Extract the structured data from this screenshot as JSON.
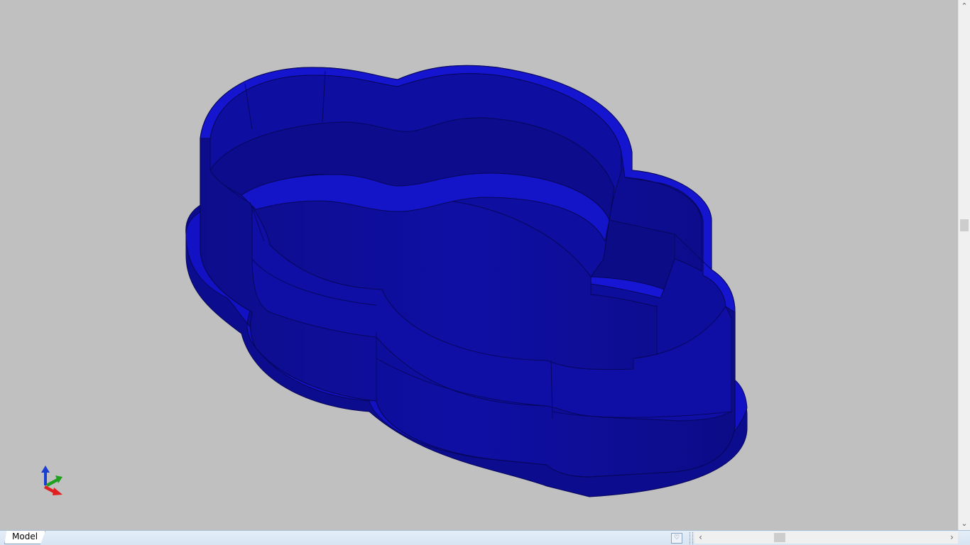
{
  "viewport": {
    "background": "#c0c0c0",
    "model_color": "#1010b0"
  },
  "axis_triad": {
    "colors": {
      "z": "#1a3fd0",
      "y": "#20a020",
      "x": "#e02020"
    }
  },
  "status_bar": {
    "tabs": [
      {
        "label": "Model",
        "active": true
      }
    ],
    "tab_menu_icon": "chevron-down-icon"
  },
  "scrollbars": {
    "vertical": {
      "up_icon": "chevron-up-icon",
      "down_icon": "chevron-down-icon"
    },
    "horizontal": {
      "left_icon": "chevron-left-icon",
      "right_icon": "chevron-right-icon"
    }
  }
}
